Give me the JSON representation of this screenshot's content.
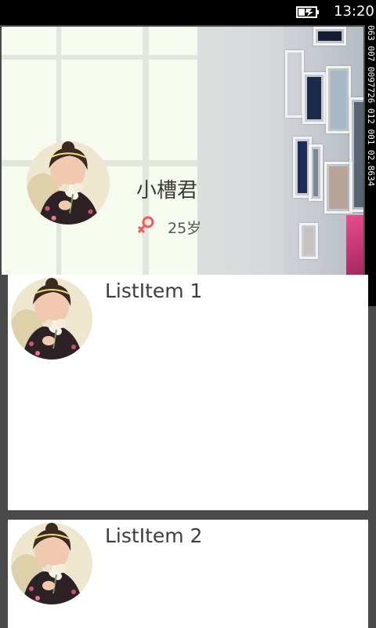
{
  "status_bar": {
    "time": "13:20",
    "battery_icon": "battery-charging-icon"
  },
  "header": {
    "user_name": "小槽君",
    "gender_icon": "female-symbol-icon",
    "age": "25岁"
  },
  "debug": {
    "counter_text": "063 007 0097726 012 001 02.8634"
  },
  "list": {
    "items": [
      {
        "title": "ListItem 1"
      },
      {
        "title": "ListItem 2"
      }
    ]
  },
  "colors": {
    "gender_accent": "#f05a5a",
    "page_bg": "#4a4a4a",
    "card_bg": "#ffffff"
  }
}
